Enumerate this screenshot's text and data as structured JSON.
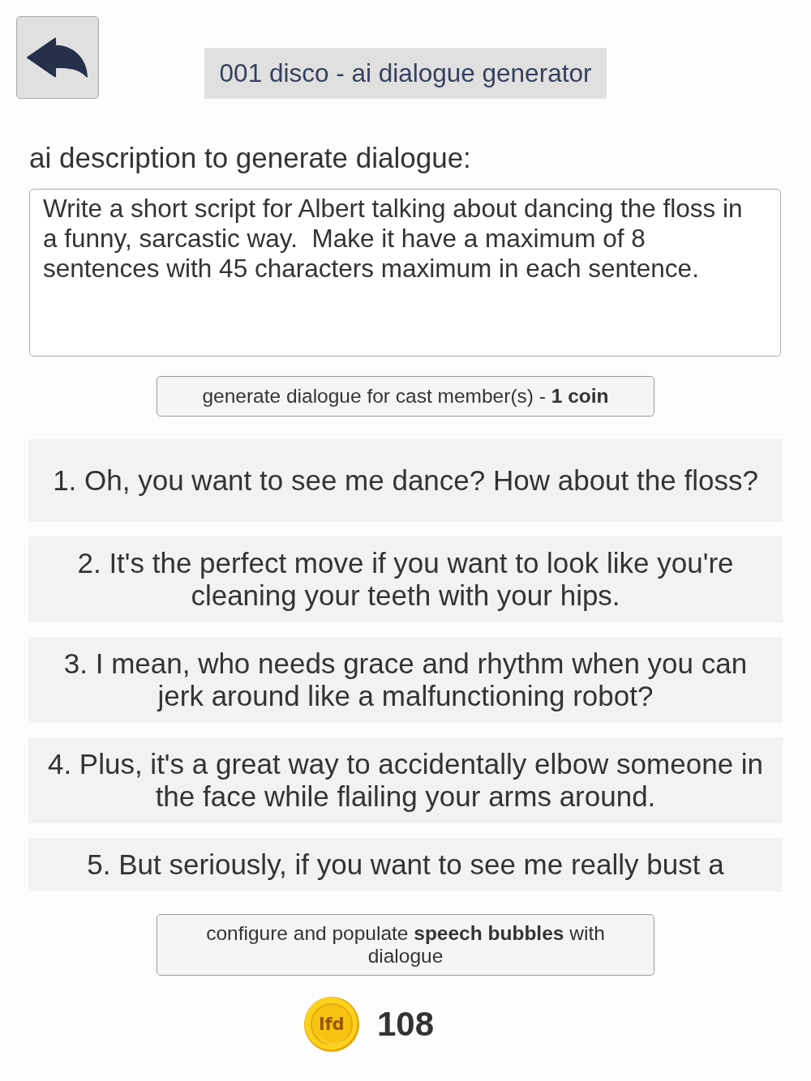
{
  "header": {
    "title": "001 disco - ai dialogue generator"
  },
  "prompt": {
    "label": "ai description to generate dialogue:",
    "value": "Write a short script for Albert talking about dancing the floss in a funny, sarcastic way.  Make it have a maximum of 8 sentences with 45 characters maximum in each sentence."
  },
  "generate_button": "generate dialogue for cast member(s) - **1 coin**",
  "dialogue_lines": [
    "1. Oh, you want to see me dance? How about the floss?",
    "2. It's the perfect move if you want to look like you're cleaning your teeth with your hips.",
    "3. I mean, who needs grace and rhythm when you can jerk around like a malfunctioning robot?",
    "4. Plus, it's a great way to accidentally elbow someone in the face while flailing your arms around.",
    "5. But seriously, if you want to see me really bust a"
  ],
  "configure_button": "configure and populate **speech bubbles** with dialogue",
  "coins": {
    "logo": "lfd",
    "count": "108"
  }
}
